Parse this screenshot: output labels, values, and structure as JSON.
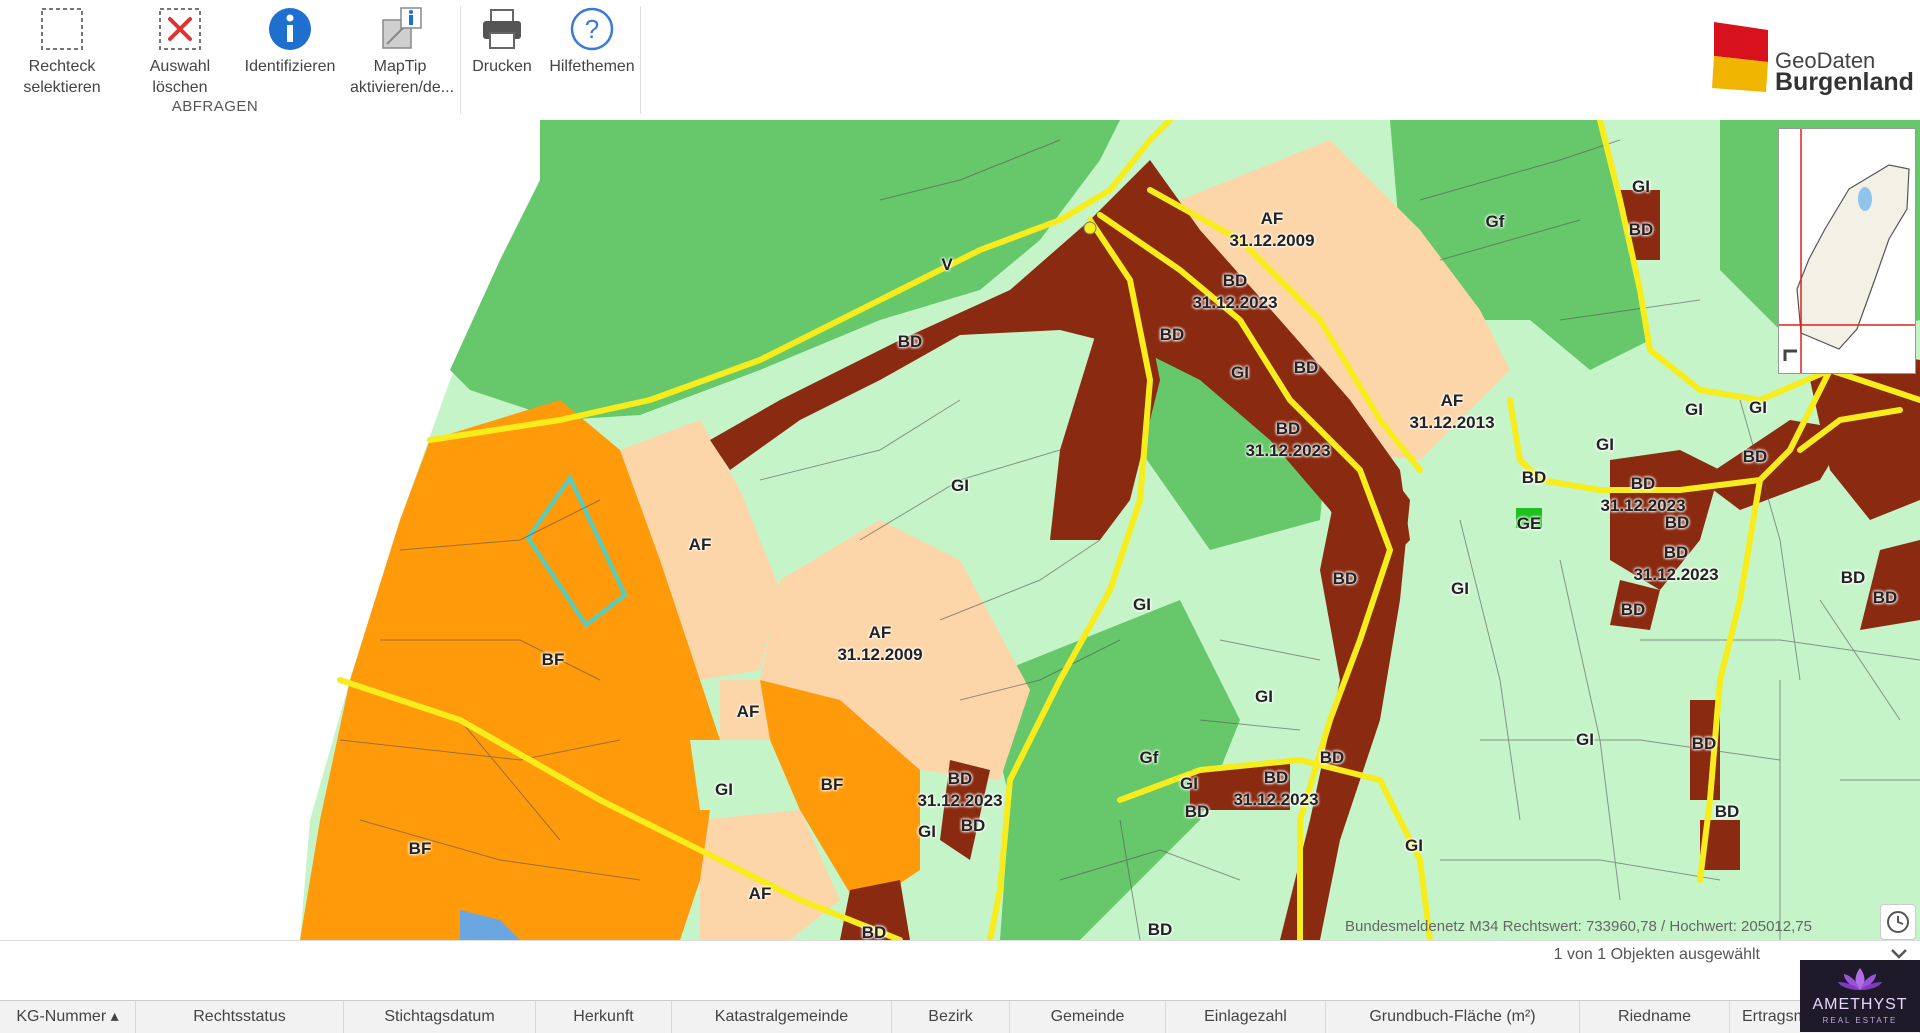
{
  "toolbar": {
    "buttons": [
      {
        "label": "Rechteck selektieren",
        "icon": "select-rectangle-icon"
      },
      {
        "label": "Auswahl löschen",
        "icon": "clear-selection-icon"
      },
      {
        "label": "Identifizieren",
        "icon": "identify-info-icon"
      },
      {
        "label": "MapTip aktivieren/de...",
        "icon": "maptip-icon"
      },
      {
        "label": "Drucken",
        "icon": "printer-icon"
      },
      {
        "label": "Hilfethemen",
        "icon": "help-icon"
      }
    ],
    "group_label": "ABFRAGEN"
  },
  "logo": {
    "line1": "GeoDaten",
    "line2": "Burgenland"
  },
  "map": {
    "labels": [
      {
        "text": "AF\n31.12.2009"
      },
      {
        "text": "BD\n31.12.2023"
      },
      {
        "text": "Gf"
      },
      {
        "text": "GI"
      },
      {
        "text": "BD"
      },
      {
        "text": "V"
      },
      {
        "text": "BD"
      },
      {
        "text": "BD"
      },
      {
        "text": "GI"
      },
      {
        "text": "BD"
      },
      {
        "text": "BD\n31.12.2023"
      },
      {
        "text": "AF\n31.12.2013"
      },
      {
        "text": "GI"
      },
      {
        "text": "GI"
      },
      {
        "text": "GI"
      },
      {
        "text": "BD"
      },
      {
        "text": "BD\n31.12.2023"
      },
      {
        "text": "BD"
      },
      {
        "text": "BD"
      },
      {
        "text": "BD\n31.12.2023"
      },
      {
        "text": "GE"
      },
      {
        "text": "GI"
      },
      {
        "text": "BD"
      },
      {
        "text": "BD"
      },
      {
        "text": "BD"
      },
      {
        "text": "GI"
      },
      {
        "text": "AF"
      },
      {
        "text": "GI"
      },
      {
        "text": "BF"
      },
      {
        "text": "AF\n31.12.2009"
      },
      {
        "text": "GI"
      },
      {
        "text": "AF"
      },
      {
        "text": "GI"
      },
      {
        "text": "BF"
      },
      {
        "text": "BD\n31.12.2023"
      },
      {
        "text": "GI"
      },
      {
        "text": "BD"
      },
      {
        "text": "Gf"
      },
      {
        "text": "GI"
      },
      {
        "text": "BD\n31.12.2023"
      },
      {
        "text": "BD"
      },
      {
        "text": "BD"
      },
      {
        "text": "GI"
      },
      {
        "text": "BD"
      },
      {
        "text": "GI"
      },
      {
        "text": "BD"
      },
      {
        "text": "BD"
      },
      {
        "text": "BF"
      },
      {
        "text": "AF"
      },
      {
        "text": "BD"
      },
      {
        "text": "BD"
      }
    ],
    "coordinates": "Bundesmeldenetz M34 Rechtswert: 733960,78 / Hochwert: 205012,75",
    "colors": {
      "forest": "#66c86a",
      "meadow": "#c6f4c9",
      "building_land": "#8a2a10",
      "af": "#fcd5a8",
      "bf": "#ff9a0a",
      "road": "#f7ec1c"
    }
  },
  "status": {
    "selection": "1 von 1 Objekten ausgewählt"
  },
  "table": {
    "columns": [
      {
        "label": "KG-Nummer ▴"
      },
      {
        "label": "Rechtsstatus"
      },
      {
        "label": "Stichtagsdatum"
      },
      {
        "label": "Herkunft"
      },
      {
        "label": "Katastralgemeinde"
      },
      {
        "label": "Bezirk"
      },
      {
        "label": "Gemeinde"
      },
      {
        "label": "Einlagezahl"
      },
      {
        "label": "Grundbuch-Fläche (m²)"
      },
      {
        "label": "Riedname"
      },
      {
        "label": "Ertragsm"
      }
    ]
  },
  "watermark": {
    "name": "AMETHYST",
    "sub": "REAL ESTATE"
  }
}
